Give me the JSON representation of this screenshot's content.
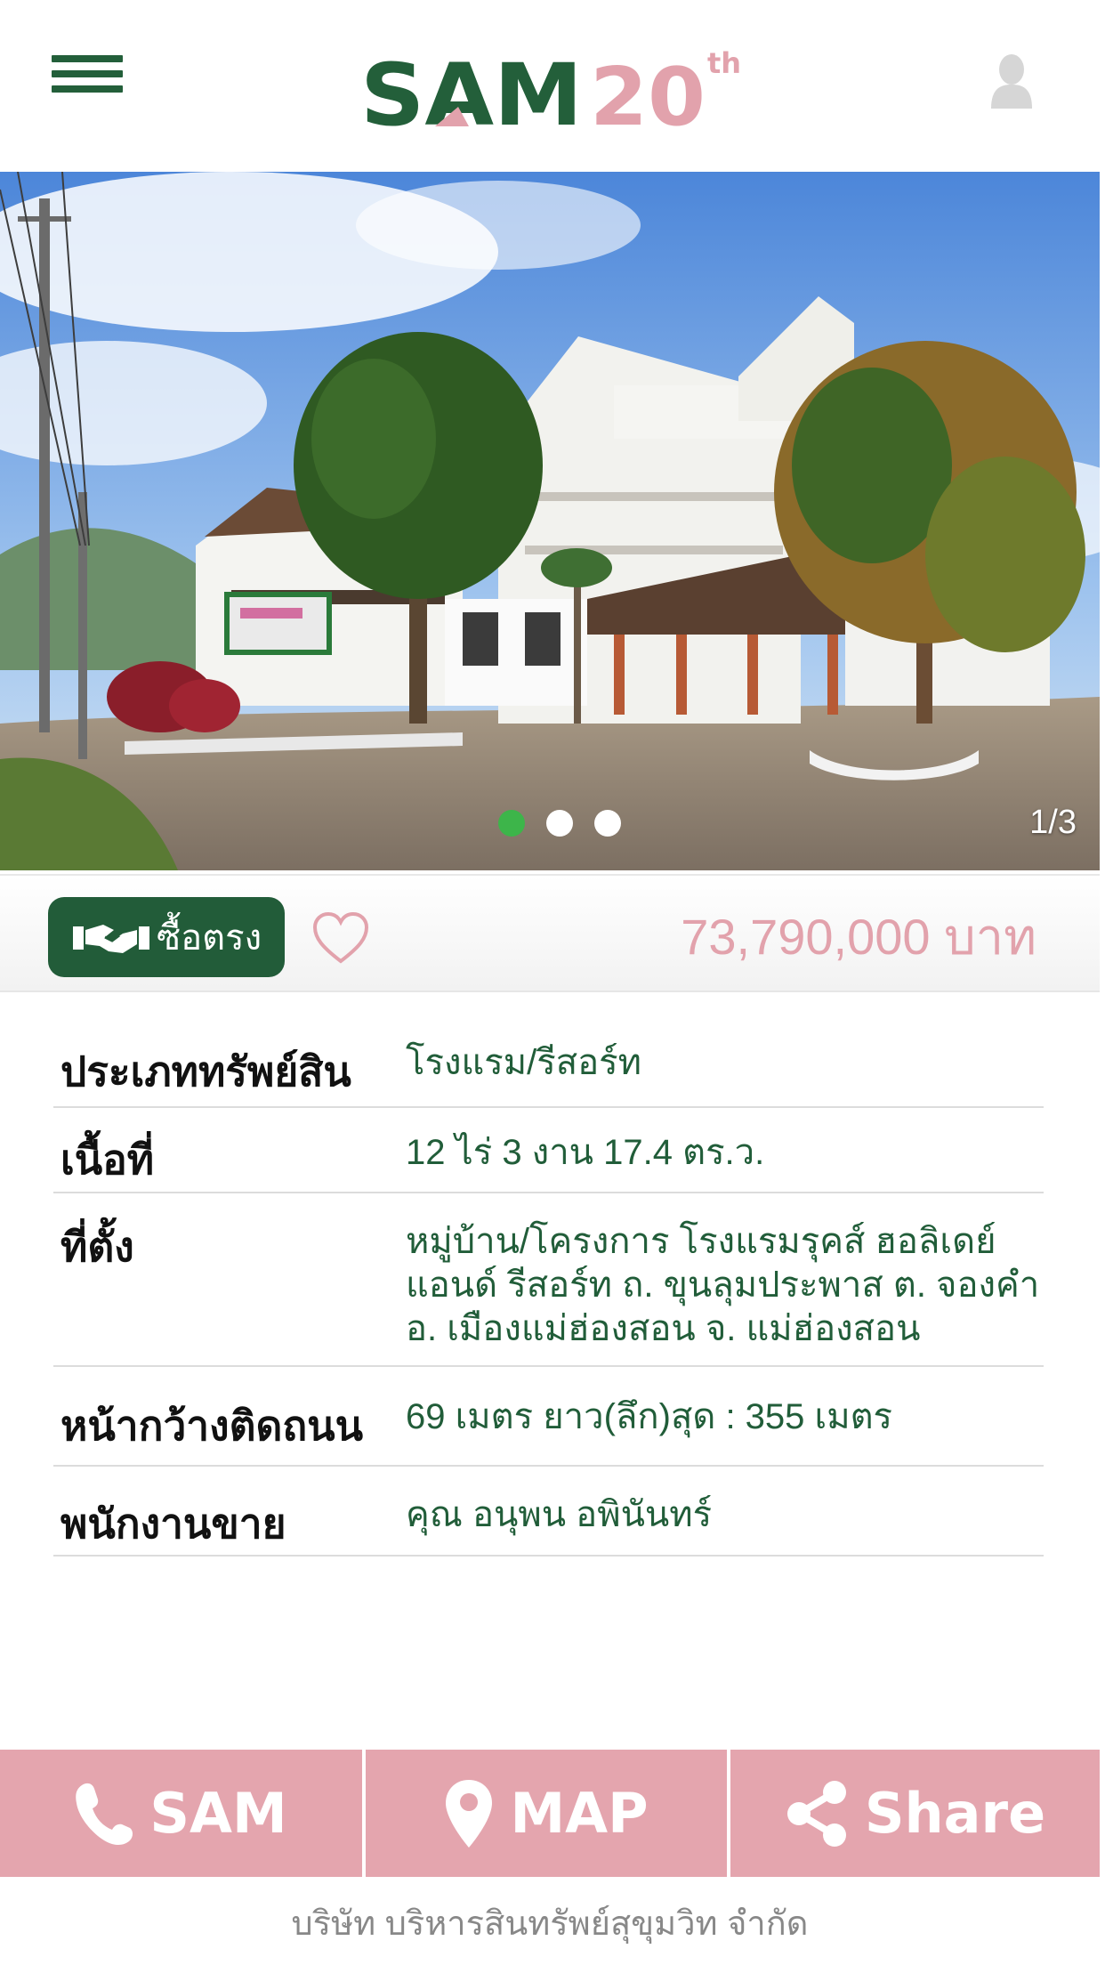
{
  "header": {
    "menu_icon": "hamburger-menu-icon",
    "logo": {
      "text": "SAM",
      "anniversary": "20",
      "suffix": "th"
    },
    "user_icon": "user-icon",
    "colors": {
      "brand_green": "#235f3a",
      "brand_pink": "#e4a5ae"
    }
  },
  "gallery": {
    "image_label": "hotel-resort-building-photo",
    "counter": "1/3",
    "slides": 3,
    "active_slide": 1
  },
  "listing": {
    "buy_label": "ซื้อตรง",
    "buy_icon": "handshake-icon",
    "favorite_icon": "heart-icon",
    "price": "73,790,000 บาท"
  },
  "details": [
    {
      "key": "ประเภททรัพย์สิน",
      "value": "โรงแรม/รีสอร์ท"
    },
    {
      "key": "เนื้อที่",
      "value": "12 ไร่ 3 งาน 17.4 ตร.ว."
    },
    {
      "key": "ที่ตั้ง",
      "value": "หมู่บ้าน/โครงการ โรงแรมรุคส์ ฮอลิเดย์\nแอนด์ รีสอร์ท ถ. ขุนลุมประพาส ต. จองคำ\nอ. เมืองแม่ฮ่องสอน จ. แม่ฮ่องสอน"
    },
    {
      "key": "หน้ากว้างติดถนน",
      "value": "69 เมตร ยาว(ลึก)สุด : 355 เมตร"
    },
    {
      "key": "พนักงานขาย",
      "value": "คุณ อนุพน อพินันทร์"
    }
  ],
  "actions": {
    "call": {
      "label": "SAM",
      "icon": "phone-icon"
    },
    "map": {
      "label": "MAP",
      "icon": "map-pin-icon"
    },
    "share": {
      "label": "Share",
      "icon": "share-icon"
    }
  },
  "footer": {
    "company": "บริษัท บริหารสินทรัพย์สุขุมวิท จำกัด"
  }
}
